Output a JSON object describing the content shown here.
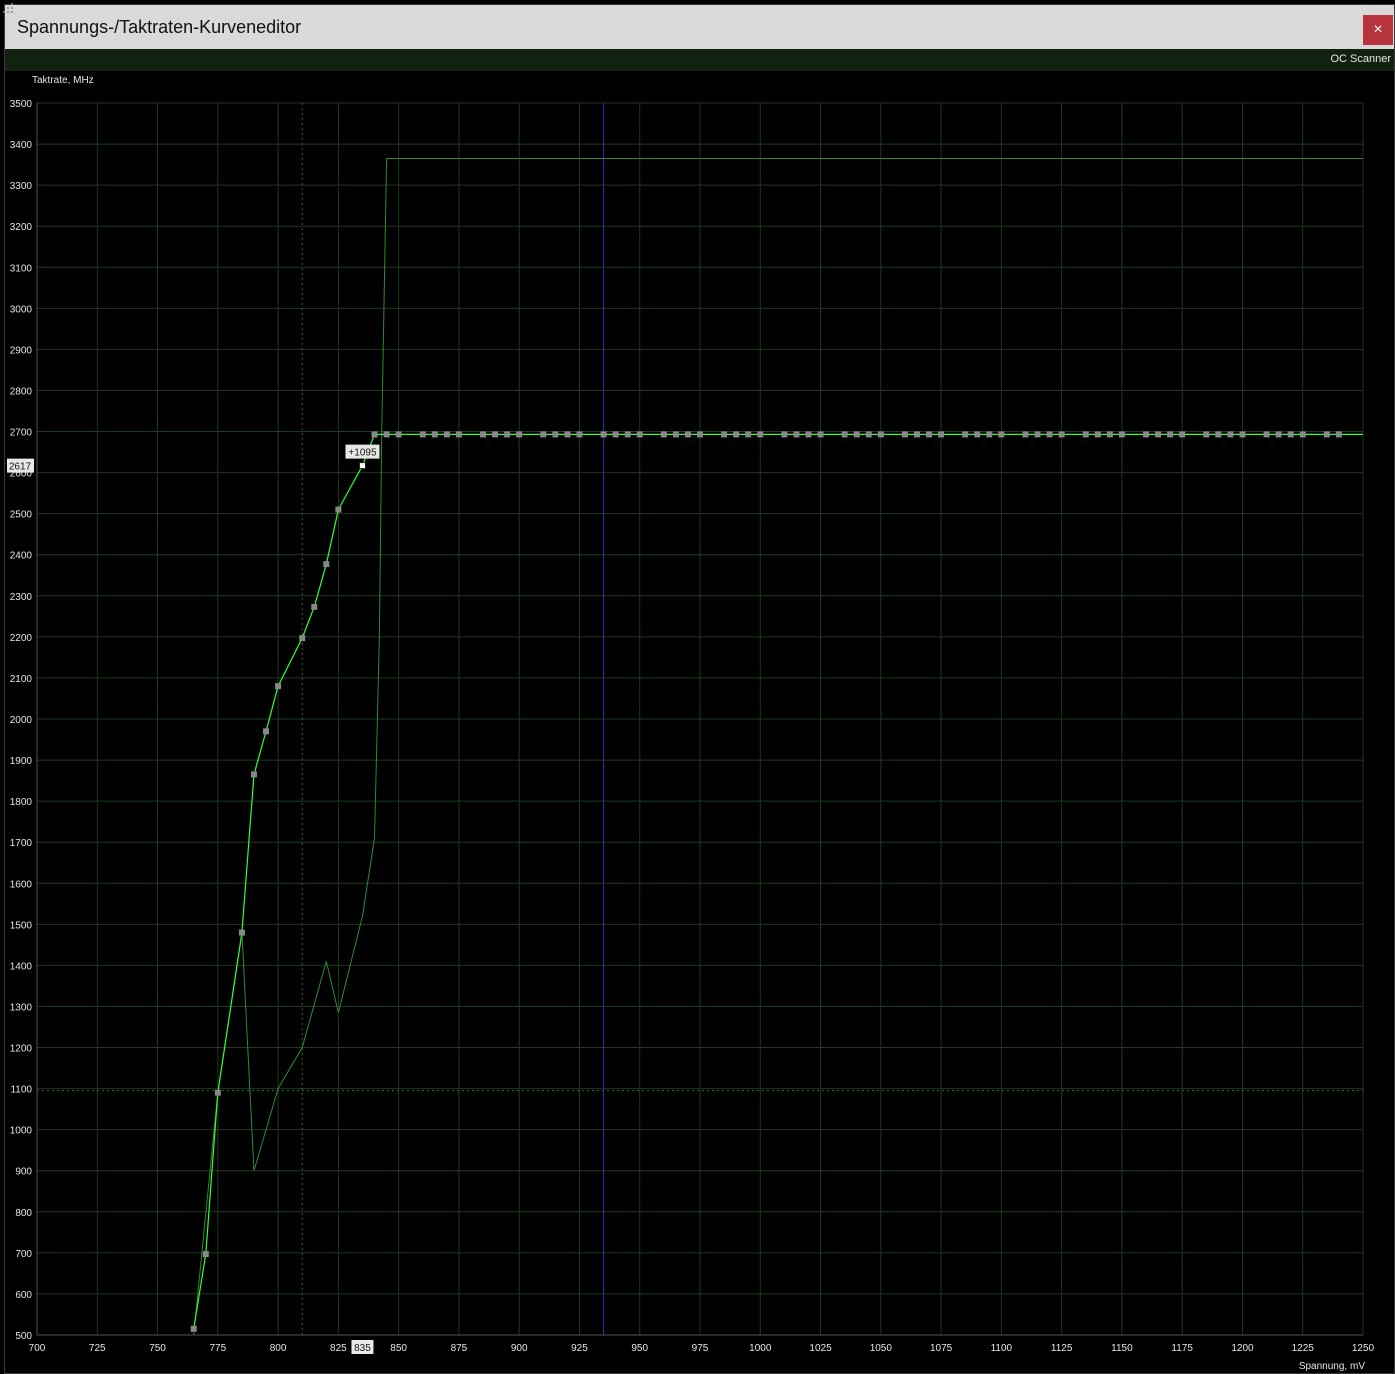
{
  "window": {
    "title": "Spannungs-/Taktraten-Kurveneditor",
    "close_label": "×"
  },
  "toolbar": {
    "oc_scanner_label": "OC Scanner"
  },
  "chart_data": {
    "type": "line",
    "xlabel": "Spannung, mV",
    "ylabel": "Taktrate, MHz",
    "xlim": [
      700,
      1250
    ],
    "ylim": [
      500,
      3500
    ],
    "x_ticks": [
      700,
      725,
      750,
      775,
      800,
      825,
      850,
      875,
      900,
      925,
      950,
      975,
      1000,
      1025,
      1050,
      1075,
      1100,
      1125,
      1150,
      1175,
      1200,
      1225,
      1250
    ],
    "y_ticks": [
      500,
      600,
      700,
      800,
      900,
      1000,
      1100,
      1200,
      1300,
      1400,
      1500,
      1600,
      1700,
      1800,
      1900,
      2000,
      2100,
      2200,
      2300,
      2400,
      2500,
      2600,
      2700,
      2800,
      2900,
      3000,
      3100,
      3200,
      3300,
      3400,
      3500
    ],
    "grid": true,
    "colors": {
      "curve": "#33ff33",
      "default_curve": "#338833",
      "grid": "#1e3a1e",
      "current_voltage_line": "#2a2a99",
      "point": "#888888"
    },
    "current_voltage": 935,
    "offset_reference_voltage": 810,
    "offset_reference_clock": 1095,
    "selected_point": {
      "x": 835,
      "y": 2617,
      "x_label": "835",
      "y_label": "2617",
      "offset_label": "+1095"
    },
    "series": [
      {
        "values": [
          [
            765,
            515
          ],
          [
            770,
            697
          ],
          [
            775,
            1090
          ],
          [
            785,
            1480
          ],
          [
            790,
            1865
          ],
          [
            795,
            1970
          ],
          [
            800,
            2080
          ],
          [
            810,
            2197
          ],
          [
            815,
            2273
          ],
          [
            820,
            2377
          ],
          [
            825,
            2510
          ],
          [
            835,
            2617
          ],
          [
            840,
            2693
          ],
          [
            845,
            2693
          ],
          [
            850,
            2693
          ],
          [
            860,
            2693
          ],
          [
            865,
            2693
          ],
          [
            870,
            2693
          ],
          [
            875,
            2693
          ],
          [
            885,
            2693
          ],
          [
            890,
            2693
          ],
          [
            895,
            2693
          ],
          [
            900,
            2693
          ],
          [
            910,
            2693
          ],
          [
            915,
            2693
          ],
          [
            920,
            2693
          ],
          [
            925,
            2693
          ],
          [
            935,
            2693
          ],
          [
            940,
            2693
          ],
          [
            945,
            2693
          ],
          [
            950,
            2693
          ],
          [
            960,
            2693
          ],
          [
            965,
            2693
          ],
          [
            970,
            2693
          ],
          [
            975,
            2693
          ],
          [
            985,
            2693
          ],
          [
            990,
            2693
          ],
          [
            995,
            2693
          ],
          [
            1000,
            2693
          ],
          [
            1010,
            2693
          ],
          [
            1015,
            2693
          ],
          [
            1020,
            2693
          ],
          [
            1025,
            2693
          ],
          [
            1035,
            2693
          ],
          [
            1040,
            2693
          ],
          [
            1045,
            2693
          ],
          [
            1050,
            2693
          ],
          [
            1060,
            2693
          ],
          [
            1065,
            2693
          ],
          [
            1070,
            2693
          ],
          [
            1075,
            2693
          ],
          [
            1085,
            2693
          ],
          [
            1090,
            2693
          ],
          [
            1095,
            2693
          ],
          [
            1100,
            2693
          ],
          [
            1110,
            2693
          ],
          [
            1115,
            2693
          ],
          [
            1120,
            2693
          ],
          [
            1125,
            2693
          ],
          [
            1135,
            2693
          ],
          [
            1140,
            2693
          ],
          [
            1145,
            2693
          ],
          [
            1150,
            2693
          ],
          [
            1160,
            2693
          ],
          [
            1165,
            2693
          ],
          [
            1170,
            2693
          ],
          [
            1175,
            2693
          ],
          [
            1185,
            2693
          ],
          [
            1190,
            2693
          ],
          [
            1195,
            2693
          ],
          [
            1200,
            2693
          ],
          [
            1210,
            2693
          ],
          [
            1215,
            2693
          ],
          [
            1220,
            2693
          ],
          [
            1225,
            2693
          ],
          [
            1235,
            2693
          ],
          [
            1240,
            2693
          ]
        ]
      },
      {
        "values": [
          [
            765,
            500
          ],
          [
            775,
            1090
          ],
          [
            785,
            1480
          ],
          [
            790,
            900
          ],
          [
            800,
            1100
          ],
          [
            810,
            1200
          ],
          [
            820,
            1410
          ],
          [
            825,
            1285
          ],
          [
            835,
            1520
          ],
          [
            840,
            1710
          ],
          [
            842,
            2200
          ],
          [
            843,
            2700
          ],
          [
            845,
            3365
          ],
          [
            1250,
            3365
          ]
        ]
      }
    ]
  }
}
